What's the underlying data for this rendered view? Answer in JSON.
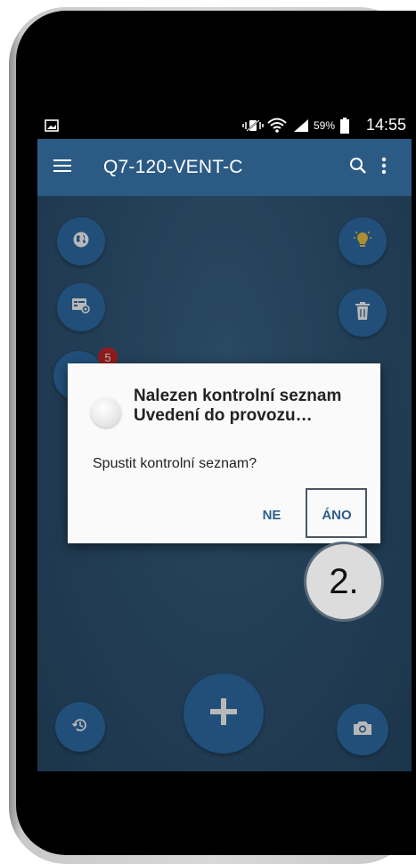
{
  "status_bar": {
    "battery_percent": "59%",
    "time": "14:55",
    "icons": [
      "gallery-icon",
      "mute-vibrate-icon",
      "wifi-icon",
      "signal-icon",
      "battery-icon"
    ]
  },
  "app_bar": {
    "title": "Q7-120-VENT-C",
    "icons": [
      "menu-icon",
      "search-icon",
      "more-vert-icon"
    ]
  },
  "actions": {
    "icons": [
      "globe-icon",
      "lightbulb-icon",
      "document-view-icon",
      "trash-icon",
      "history-icon",
      "add-icon",
      "camera-icon"
    ],
    "badge_count": "5"
  },
  "dialog": {
    "title": "Nalezen kontrolní seznam Uvedení do provozu…",
    "message": "Spustit kontrolní seznam?",
    "negative_label": "NE",
    "positive_label": "ÁNO"
  },
  "callout": {
    "step_label": "2."
  },
  "colors": {
    "app_bar": "#2b5b85",
    "fab": "#2f6ea8",
    "badge": "#c62828",
    "dialog_button": "#2c5f8a"
  }
}
